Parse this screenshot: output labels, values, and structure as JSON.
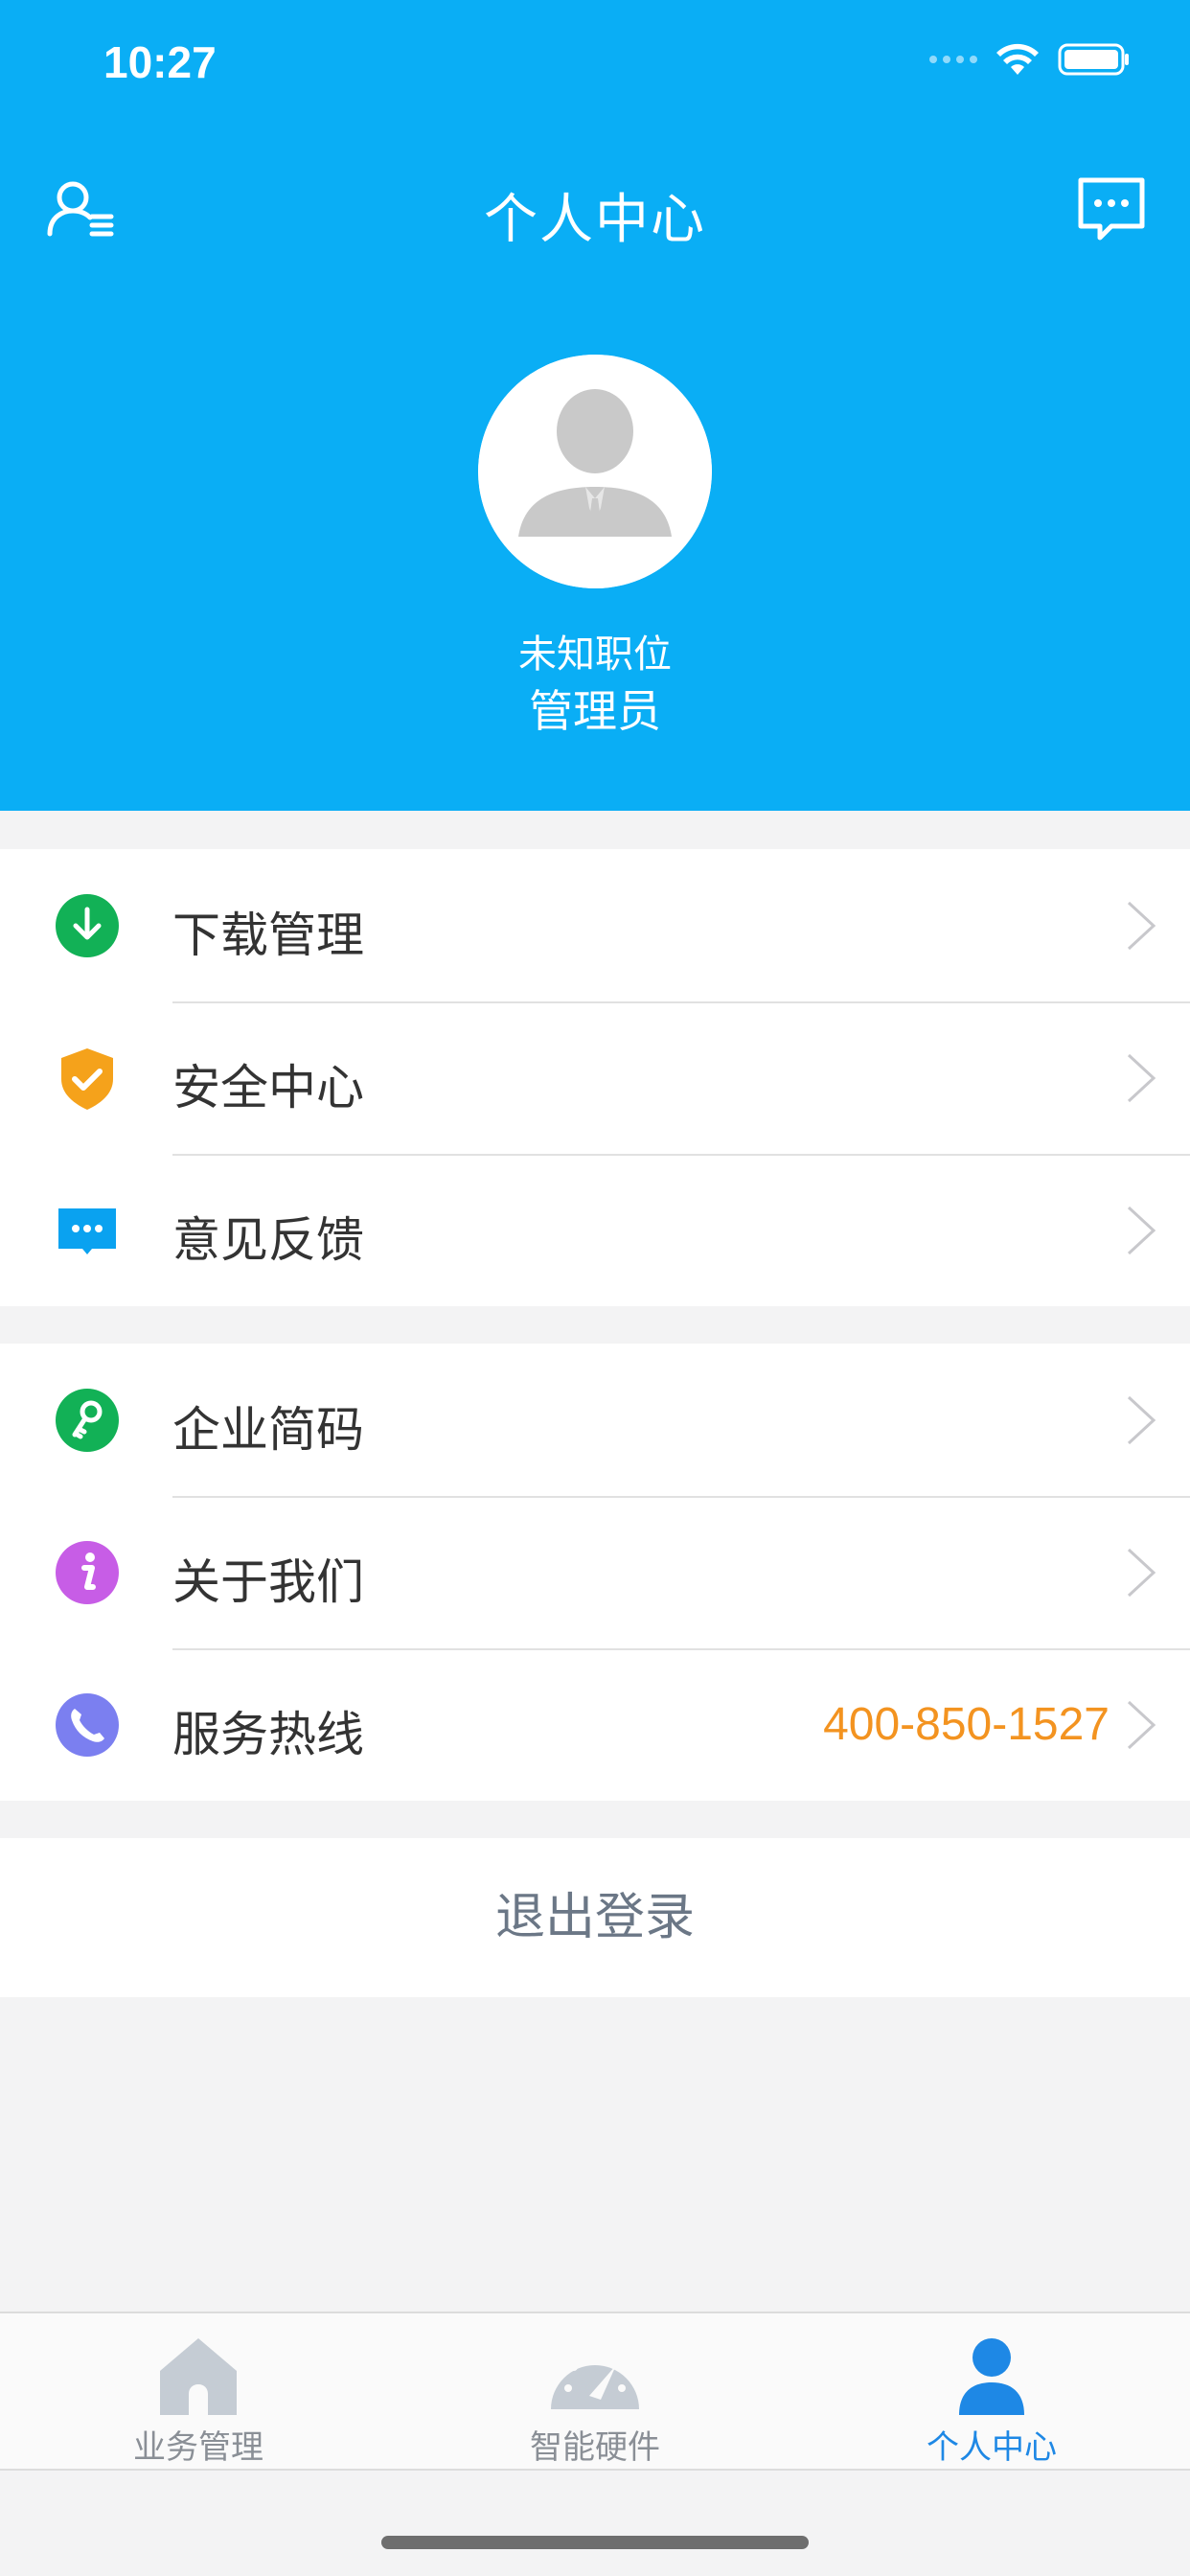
{
  "status_bar": {
    "time": "10:27"
  },
  "header": {
    "title": "个人中心",
    "left_icon": "user-list-icon",
    "right_icon": "message-icon"
  },
  "profile": {
    "position": "未知职位",
    "role": "管理员",
    "avatar_icon": "avatar-icon"
  },
  "menu_group_1": [
    {
      "label": "下载管理",
      "icon": "download-icon",
      "color": "#12b156"
    },
    {
      "label": "安全中心",
      "icon": "shield-check-icon",
      "color": "#f5a21b"
    },
    {
      "label": "意见反馈",
      "icon": "feedback-icon",
      "color": "#0aa2f0"
    }
  ],
  "menu_group_2": [
    {
      "label": "企业简码",
      "icon": "key-icon",
      "color": "#12b156"
    },
    {
      "label": "关于我们",
      "icon": "info-icon",
      "color": "#c75de6"
    },
    {
      "label": "服务热线",
      "icon": "phone-icon",
      "color": "#7b7ff0",
      "value": "400-850-1527"
    }
  ],
  "logout": {
    "label": "退出登录"
  },
  "tabbar": [
    {
      "label": "业务管理",
      "icon": "home-icon",
      "active": false
    },
    {
      "label": "智能硬件",
      "icon": "gauge-icon",
      "active": false
    },
    {
      "label": "个人中心",
      "icon": "person-icon",
      "active": true
    }
  ],
  "colors": {
    "brand": "#0aaef5",
    "accent": "#f39320",
    "active_tab": "#1e88e5"
  }
}
